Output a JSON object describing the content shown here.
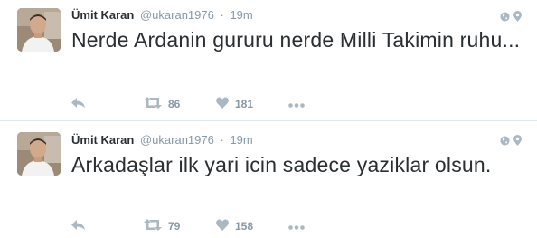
{
  "tweets": [
    {
      "fullname": "Ümit Karan",
      "username": "@ukaran1976",
      "separator": "·",
      "time": "19m",
      "text": "Nerde Ardanin gururu nerde Milli Takimin ruhu...",
      "retweets": "86",
      "likes": "181"
    },
    {
      "fullname": "Ümit Karan",
      "username": "@ukaran1976",
      "separator": "·",
      "time": "19m",
      "text": "Arkadaşlar ilk yari icin sadece yaziklar olsun.",
      "retweets": "79",
      "likes": "158"
    }
  ],
  "icons": {
    "reply": "reply-icon",
    "retweet": "retweet-icon",
    "like": "heart-icon",
    "more": "more-icon",
    "globe": "globe-icon",
    "location": "location-pin-icon"
  },
  "colors": {
    "text": "#292f33",
    "muted": "#8899a6",
    "divider": "#e1e8ed"
  }
}
